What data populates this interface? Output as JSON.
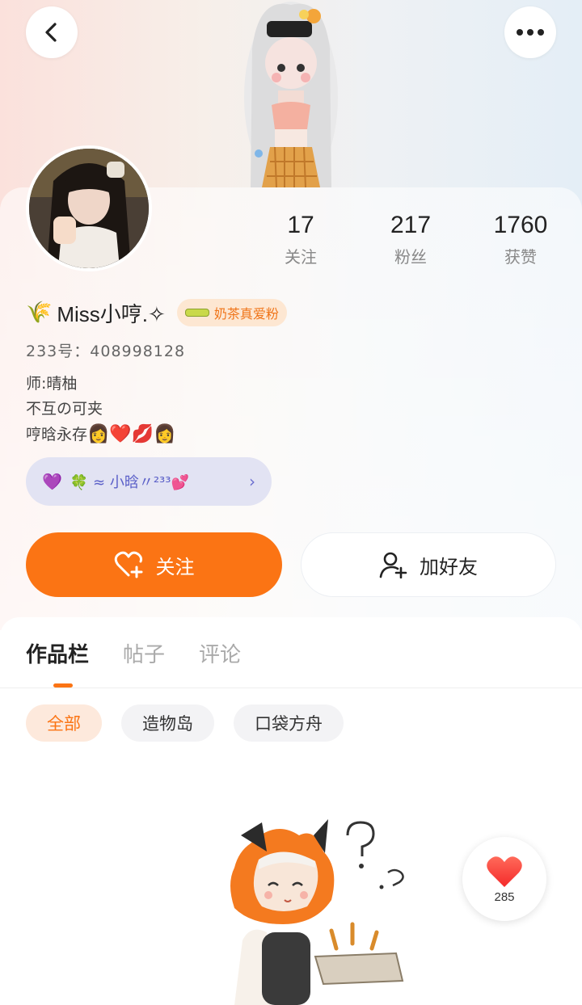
{
  "header": {
    "back_icon": "chevron-left-icon",
    "more_icon": "more-dots-icon"
  },
  "profile": {
    "name": "Miss小哼.✧",
    "name_prefix_icon": "🌾",
    "badge_text": "奶茶真爱粉",
    "uid_label": "233号：",
    "uid": "408998128",
    "bio_lines": [
      "师:晴柚",
      "不互の可夹",
      "哼晗永存"
    ],
    "bio_emoji": "👩❤️💋👩",
    "club_text": "🍀 ≈ 小晗〃²³³💕",
    "club_icon": "💜"
  },
  "stats": [
    {
      "value": "17",
      "label": "关注"
    },
    {
      "value": "217",
      "label": "粉丝"
    },
    {
      "value": "1760",
      "label": "获赞"
    }
  ],
  "actions": {
    "follow_label": "关注",
    "add_friend_label": "加好友"
  },
  "tabs": [
    {
      "label": "作品栏",
      "active": true
    },
    {
      "label": "帖子",
      "active": false
    },
    {
      "label": "评论",
      "active": false
    }
  ],
  "filters": [
    {
      "label": "全部",
      "active": true
    },
    {
      "label": "造物岛",
      "active": false
    },
    {
      "label": "口袋方舟",
      "active": false
    }
  ],
  "like_fab": {
    "count": "285"
  },
  "colors": {
    "accent": "#fb7414",
    "club_text": "#5a5fc8"
  }
}
